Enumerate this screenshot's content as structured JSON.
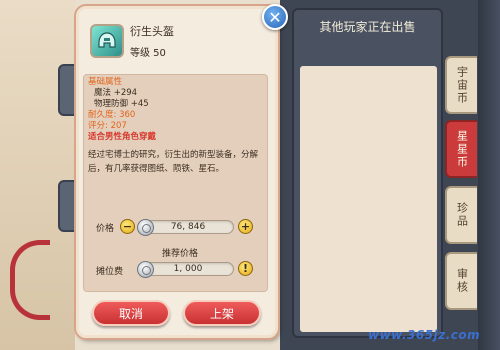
{
  "item": {
    "name": "衍生头盔",
    "level": "等级 50",
    "icon": "helmet-icon"
  },
  "stats": {
    "header": "基础属性",
    "magic": "魔法 +294",
    "phys_def": "物理防御 +45",
    "durability": "耐久度: 360",
    "score": "评分: 207",
    "restriction": "适合男性角色穿戴"
  },
  "description": "经过宅博士的研究，衍生出的新型装备，分解后，有几率获得图纸、陨铁、星石。",
  "price": {
    "label": "价格",
    "value": "76, 846",
    "recommend_label": "推荐价格"
  },
  "fee": {
    "label": "摊位费",
    "value": "1, 000"
  },
  "buttons": {
    "cancel": "取消",
    "list": "上架",
    "close": "✕",
    "minus": "−",
    "plus": "+",
    "info": "!"
  },
  "market": {
    "title": "其他玩家正在出售"
  },
  "tabs": [
    {
      "label": "宇宙币",
      "active": false
    },
    {
      "label": "星星币",
      "active": true
    },
    {
      "label": "珍品",
      "active": false
    },
    {
      "label": "审核",
      "active": false
    }
  ],
  "watermark": "www.365jz.com",
  "colors": {
    "accent_red": "#cc3b3b",
    "stat_orange": "#e0641b",
    "restriction_red": "#d63a2e",
    "close_blue": "#2a66b9"
  }
}
